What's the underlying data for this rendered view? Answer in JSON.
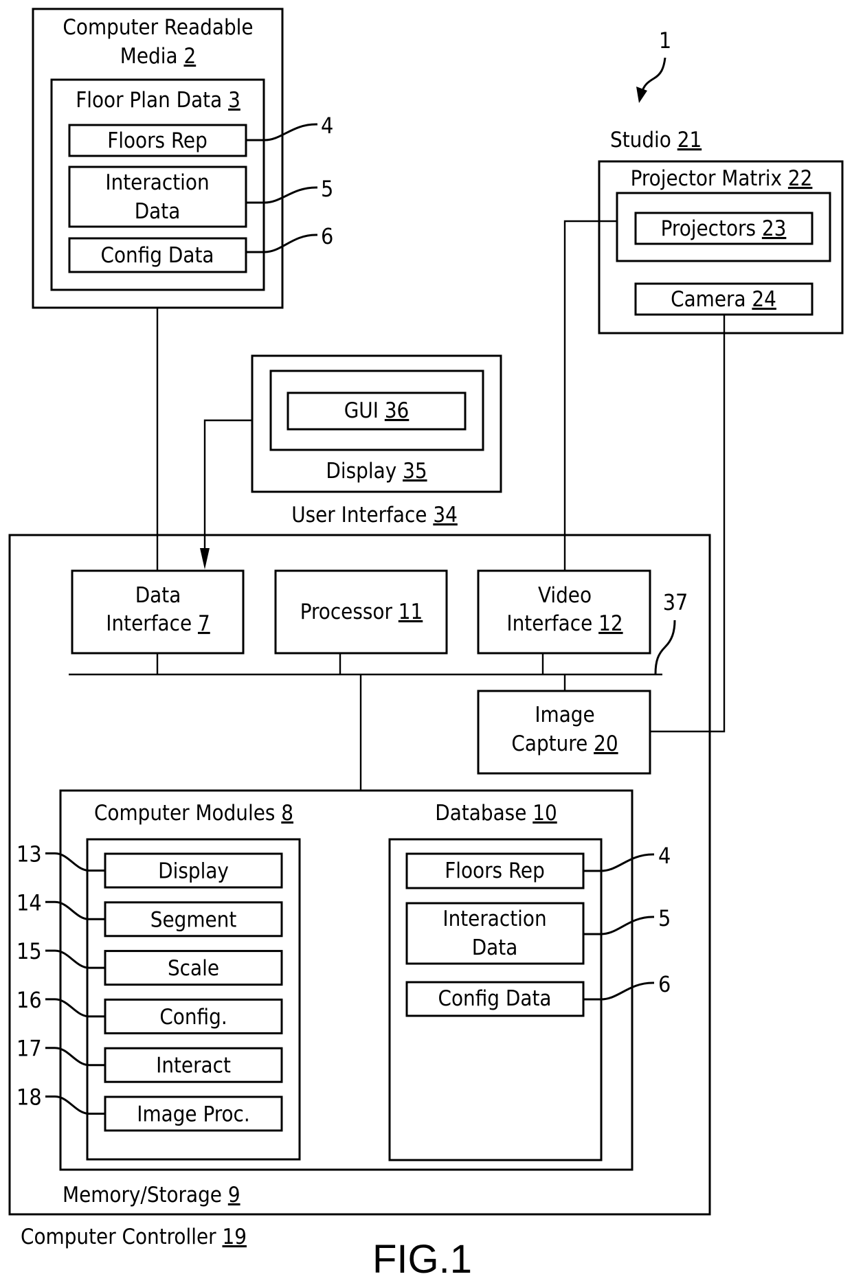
{
  "figure": {
    "label": "FIG.1",
    "system_ref": "1"
  },
  "crm": {
    "title_line1": "Computer Readable",
    "title_line2": "Media",
    "ref": "2",
    "floor_plan": {
      "title": "Floor Plan Data",
      "ref": "3",
      "items": [
        {
          "lines": [
            "Floors Rep"
          ],
          "ref": "4"
        },
        {
          "lines": [
            "Interaction",
            "Data"
          ],
          "ref": "5"
        },
        {
          "lines": [
            "Config Data"
          ],
          "ref": "6"
        }
      ]
    }
  },
  "studio": {
    "title": "Studio",
    "ref": "21",
    "projector_matrix": {
      "title": "Projector Matrix",
      "ref": "22"
    },
    "projectors": {
      "title": "Projectors",
      "ref": "23"
    },
    "camera": {
      "title": "Camera",
      "ref": "24"
    }
  },
  "user_interface": {
    "title": "User Interface",
    "ref": "34",
    "display": {
      "title": "Display",
      "ref": "35"
    },
    "gui": {
      "title": "GUI",
      "ref": "36"
    }
  },
  "controller": {
    "title": "Computer Controller",
    "ref": "19",
    "bus_ref": "37",
    "data_interface": {
      "line1": "Data",
      "line2": "Interface",
      "ref": "7"
    },
    "processor": {
      "title": "Processor",
      "ref": "11"
    },
    "video_interface": {
      "line1": "Video",
      "line2": "Interface",
      "ref": "12"
    },
    "image_capture": {
      "line1": "Image",
      "line2": "Capture",
      "ref": "20"
    },
    "memory": {
      "title": "Memory/Storage",
      "ref": "9",
      "modules": {
        "title": "Computer Modules",
        "ref": "8",
        "items": [
          {
            "label": "Display",
            "ref": "13"
          },
          {
            "label": "Segment",
            "ref": "14"
          },
          {
            "label": "Scale",
            "ref": "15"
          },
          {
            "label": "Config.",
            "ref": "16"
          },
          {
            "label": "Interact",
            "ref": "17"
          },
          {
            "label": "Image Proc.",
            "ref": "18"
          }
        ]
      },
      "database": {
        "title": "Database",
        "ref": "10",
        "items": [
          {
            "lines": [
              "Floors Rep"
            ],
            "ref": "4"
          },
          {
            "lines": [
              "Interaction",
              "Data"
            ],
            "ref": "5"
          },
          {
            "lines": [
              "Config Data"
            ],
            "ref": "6"
          }
        ]
      }
    }
  }
}
